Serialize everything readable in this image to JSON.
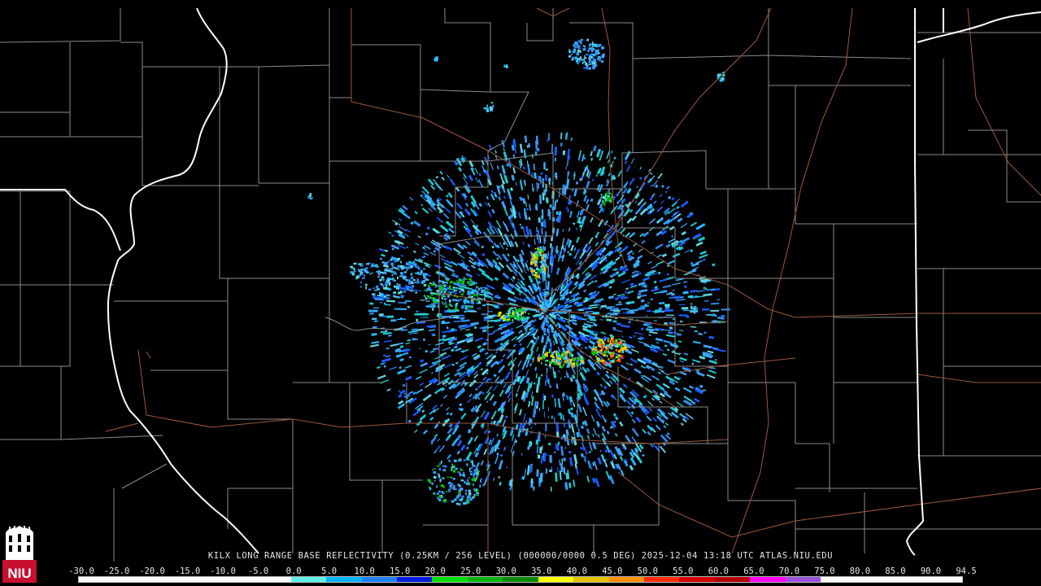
{
  "caption": "KILX LONG RANGE BASE REFLECTIVITY (0.25KM / 256 LEVEL) (000000/0000 0.5 DEG) 2025-12-04 13:18 UTC  ATLAS.NIU.EDU",
  "logo": {
    "text": "NIU",
    "icon": "niu-altgeld-tower-icon",
    "color": "#c8102e"
  },
  "scale": {
    "labels": [
      "-30.0",
      "-25.0",
      "-20.0",
      "-15.0",
      "-10.0",
      "-5.0",
      "0.0",
      "5.0",
      "10.0",
      "15.0",
      "20.0",
      "25.0",
      "30.0",
      "35.0",
      "40.0",
      "45.0",
      "50.0",
      "55.0",
      "60.0",
      "65.0",
      "70.0",
      "75.0",
      "80.0",
      "85.0",
      "90.0",
      "94.5"
    ],
    "colors": [
      "#ffffff",
      "#ffffff",
      "#ffffff",
      "#ffffff",
      "#ffffff",
      "#ffffff",
      "#5ff0e8",
      "#00b4ff",
      "#1a7fff",
      "#0018e0",
      "#00e000",
      "#00b400",
      "#008a00",
      "#ffff00",
      "#e6c000",
      "#ff9000",
      "#ff2a00",
      "#d40000",
      "#b40000",
      "#ff00ff",
      "#9b50e0",
      "#ffffff",
      "#ffffff",
      "#ffffff",
      "#ffffff"
    ]
  },
  "map_colors": {
    "county_lines": "#8c8c8c",
    "state_lines": "#ffffff",
    "highways": "#9c5a3c",
    "background": "#000000"
  },
  "radar": {
    "site": "KILX",
    "palette": [
      "#3fa0ff",
      "#2e86e8",
      "#5fd6e0",
      "#1ec8d0",
      "#2cb4ff",
      "#1a5cff",
      "#00c800",
      "#00a000",
      "#d8e000",
      "#ffb000",
      "#ff3c00"
    ]
  }
}
